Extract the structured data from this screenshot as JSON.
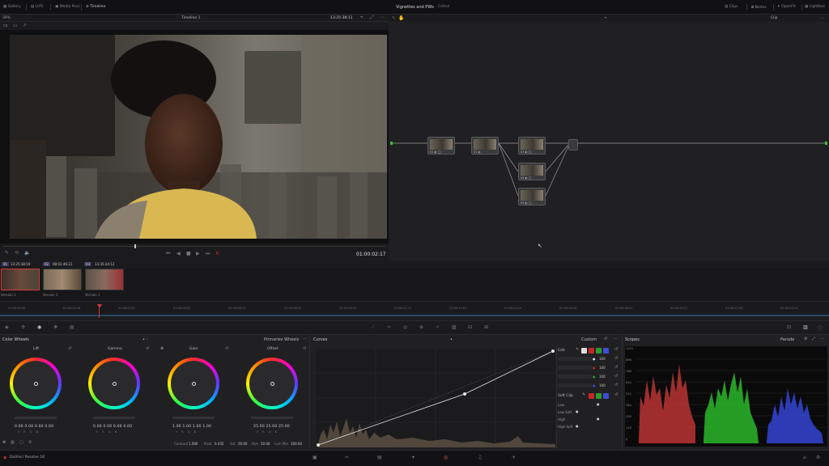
{
  "topbar": {
    "gallery": "Gallery",
    "luts": "LUTs",
    "media_pool": "Media Pool",
    "timeline": "Timeline",
    "center_title": "Vignettes and PWs",
    "center_sub": "Edited",
    "clips": "Clips",
    "nodes": "Nodes",
    "openfx": "OpenFX",
    "lightbox": "Lightbox"
  },
  "viewer": {
    "zoom": "39%",
    "timeline_name": "Timeline 1",
    "timecode_top": "13:25:38:11",
    "timecode_main": "01:00:02:17",
    "node_mode": "Clip"
  },
  "clips": {
    "items": [
      {
        "track": "01",
        "tc": "13:25:38:19",
        "version": "Version 1"
      },
      {
        "track": "02",
        "tc": "08:01:46:21",
        "version": "Version 1"
      },
      {
        "track": "03",
        "tc": "13:35:34:12",
        "version": "Version 1"
      }
    ]
  },
  "ruler": {
    "ticks": [
      "01:00:00:00",
      "01:00:01:16",
      "01:00:03:07",
      "01:00:04:23",
      "01:00:06:14",
      "01:00:08:05",
      "01:00:09:21",
      "01:00:11:12",
      "01:00:13:03",
      "01:00:14:19",
      "01:00:16:10",
      "01:00:18:01",
      "01:00:19:17",
      "01:00:21:08",
      "01:00:22:24"
    ]
  },
  "color_wheels": {
    "title": "Color Wheels",
    "mode": "Primaries Wheels",
    "wheels": [
      {
        "name": "Lift",
        "values": "0.00  0.00  0.00  0.00"
      },
      {
        "name": "Gamma",
        "values": "0.00  0.00  0.00  0.00"
      },
      {
        "name": "Gain",
        "values": "1.00  1.00  1.00  1.00"
      },
      {
        "name": "Offset",
        "values": "25.00  25.00  25.00"
      }
    ],
    "ychannels": "Y  R  G  B",
    "params": [
      {
        "label": "Contrast",
        "value": "1.000"
      },
      {
        "label": "Pivot",
        "value": "0.435"
      },
      {
        "label": "Sat",
        "value": "50.00"
      },
      {
        "label": "Hue",
        "value": "50.00"
      },
      {
        "label": "Lum Mix",
        "value": "100.00"
      }
    ]
  },
  "curves": {
    "title": "Curves",
    "mode": "Custom",
    "edit": "Edit",
    "values": [
      "100",
      "100",
      "100",
      "100"
    ],
    "soft_clip": "Soft Clip",
    "soft_rows": [
      "Low",
      "Low Soft",
      "High",
      "High Soft"
    ]
  },
  "scopes": {
    "title": "Scopes",
    "mode": "Parade",
    "scale": [
      "1023",
      "896",
      "768",
      "640",
      "512",
      "384",
      "256",
      "128",
      "0"
    ]
  },
  "bottom": {
    "app": "DaVinci Resolve 16"
  },
  "colors": {
    "accent_red": "#d23b3b",
    "node_green": "#3dbb3d"
  }
}
